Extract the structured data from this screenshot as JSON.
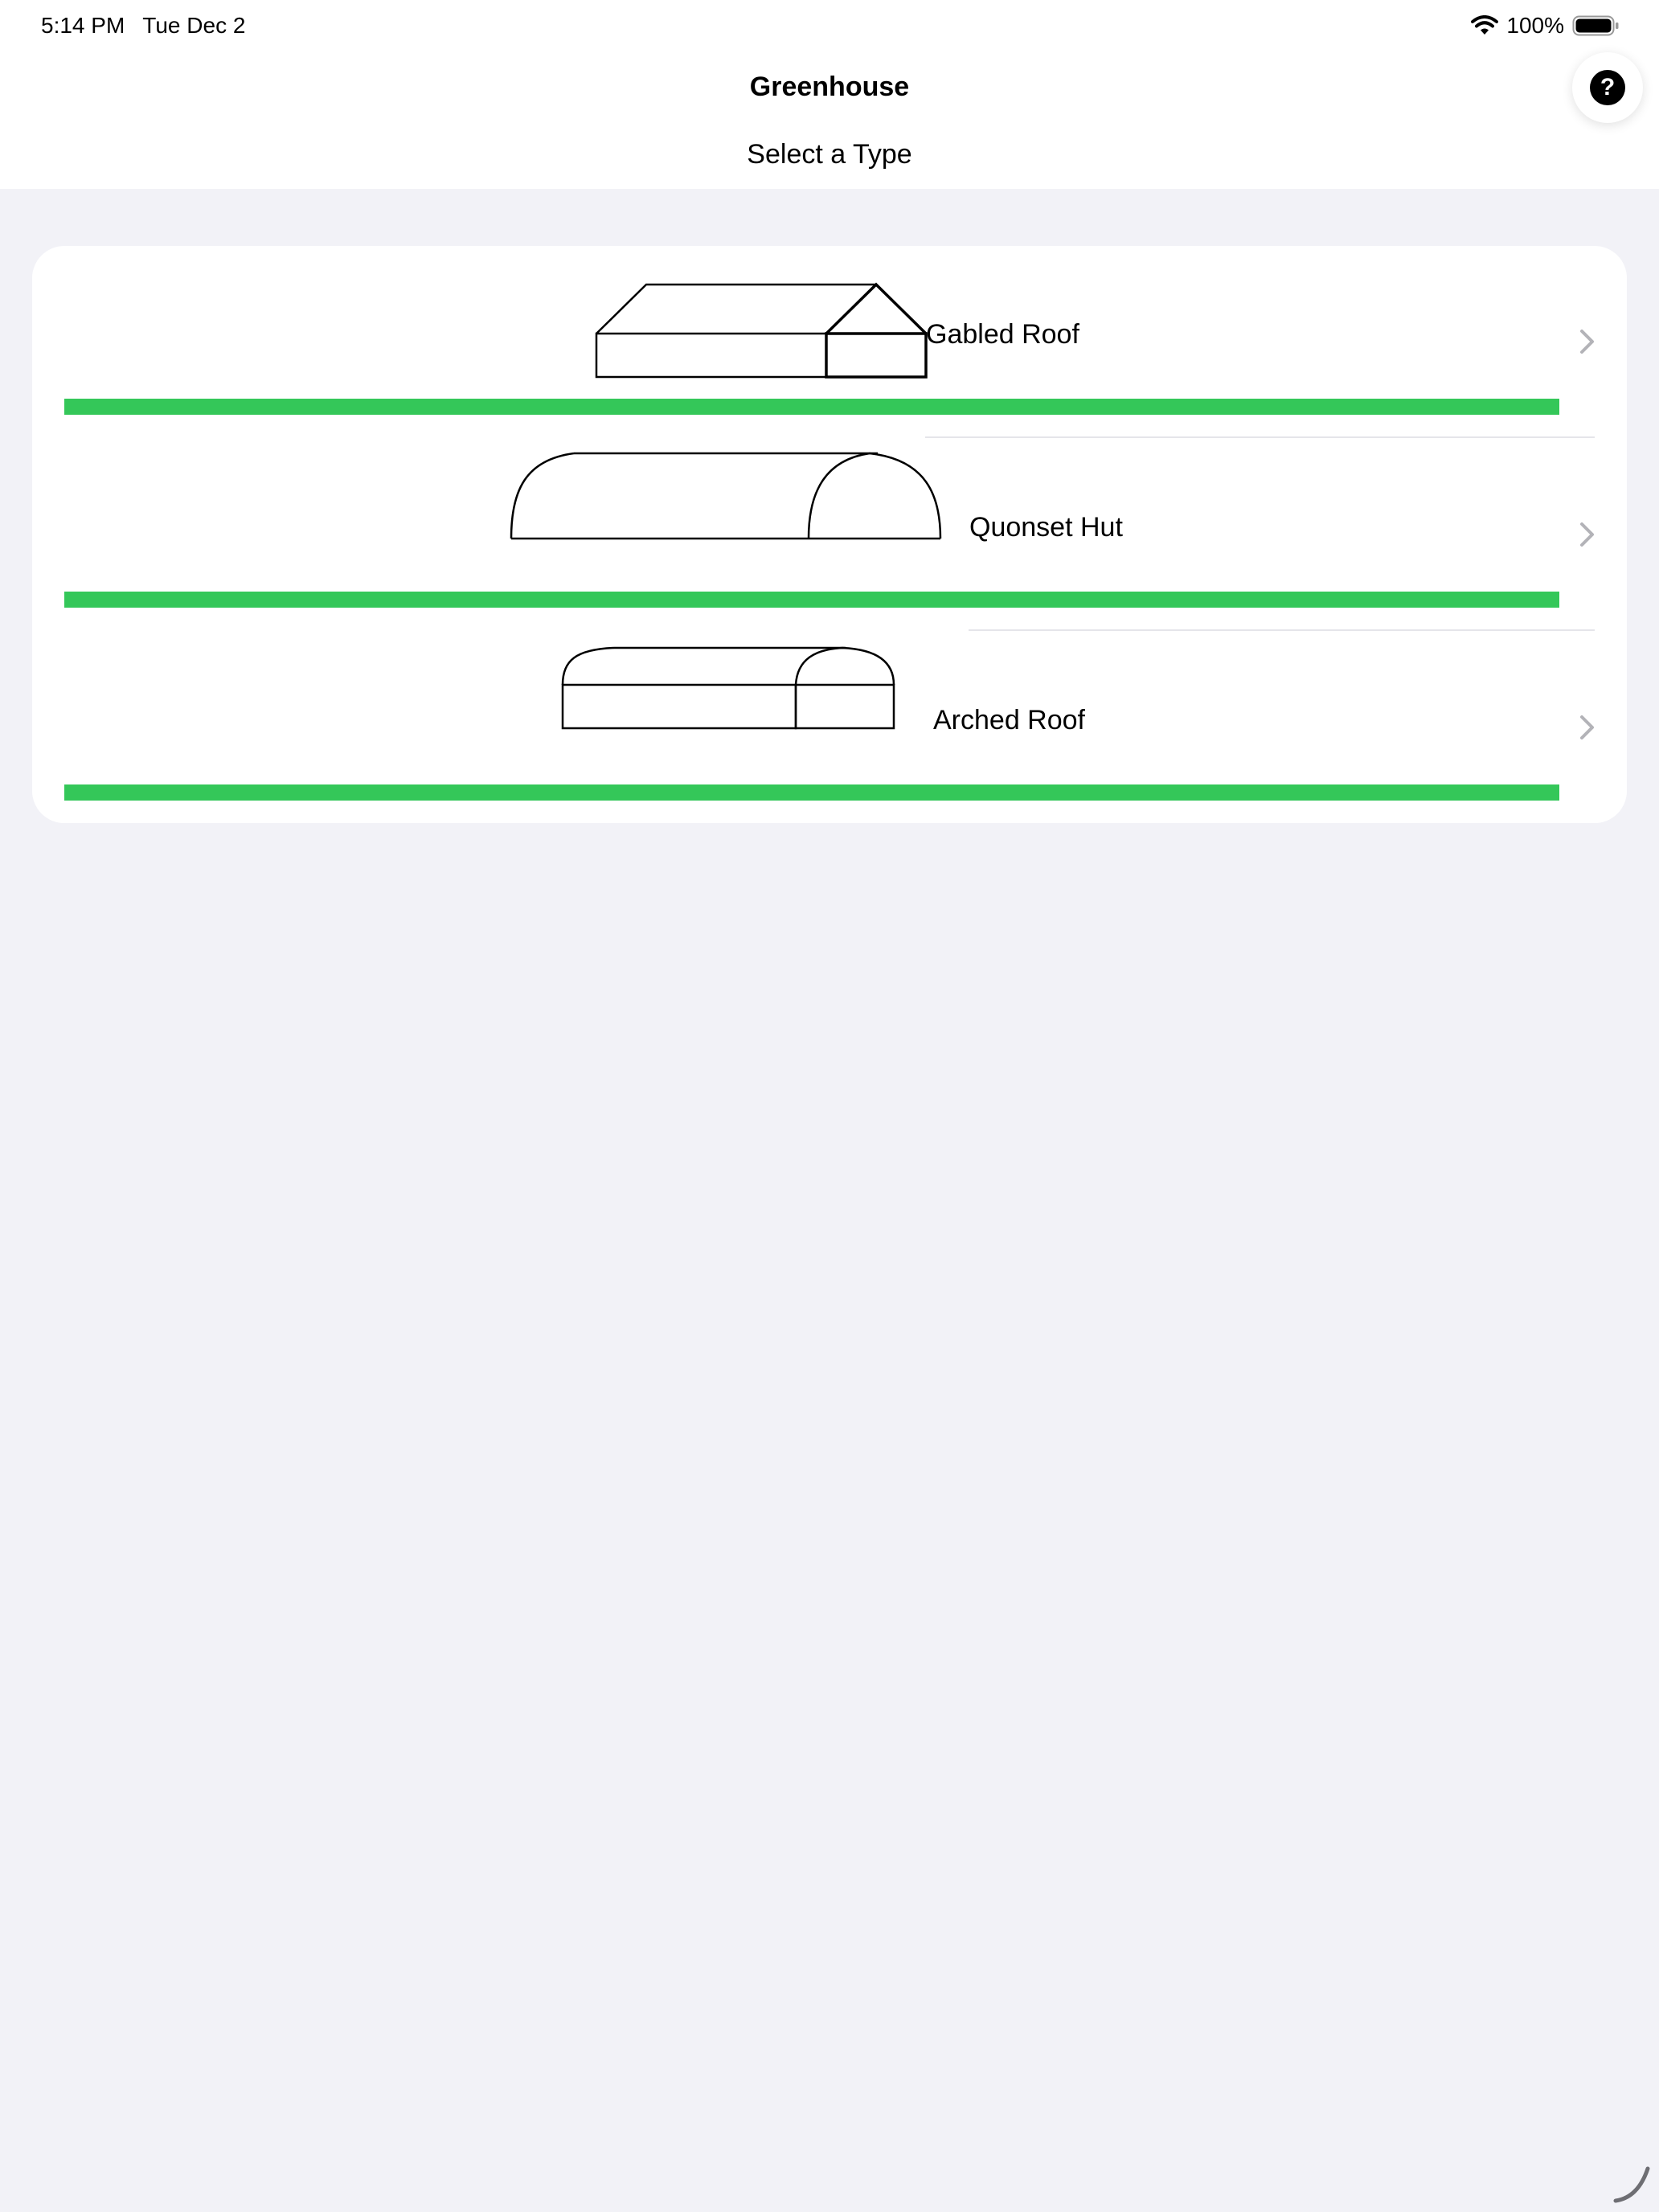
{
  "status_bar": {
    "time": "5:14 PM",
    "date": "Tue Dec 2",
    "battery": "100%",
    "wifi_icon": "wifi-icon",
    "battery_icon": "battery-full-icon"
  },
  "nav": {
    "title": "Greenhouse",
    "help_label": "?"
  },
  "subtitle": "Select a Type",
  "colors": {
    "progress": "#34c759",
    "background": "#f2f2f7",
    "card": "#ffffff"
  },
  "types": [
    {
      "label": "Gabled Roof",
      "icon": "gabled-roof-icon",
      "progress": 1.0
    },
    {
      "label": "Quonset Hut",
      "icon": "quonset-hut-icon",
      "progress": 1.0
    },
    {
      "label": "Arched Roof",
      "icon": "arched-roof-icon",
      "progress": 1.0
    }
  ]
}
